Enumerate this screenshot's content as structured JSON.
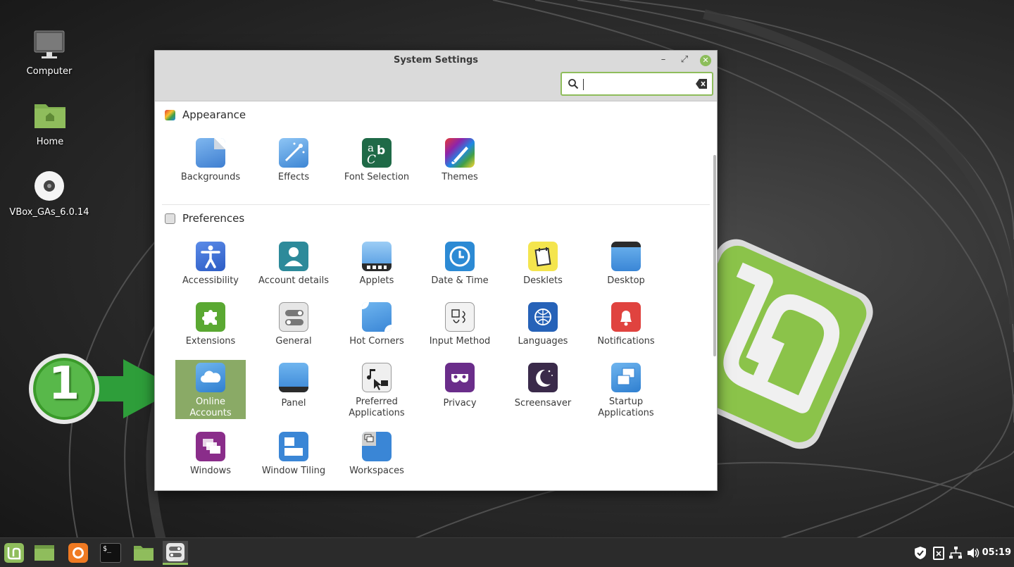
{
  "desktop": {
    "icons": [
      {
        "label": "Computer"
      },
      {
        "label": "Home"
      },
      {
        "label": "VBox_GAs_6.0.14"
      }
    ]
  },
  "window": {
    "title": "System Settings",
    "controls": {
      "minimize": "–",
      "maximize": "⤢",
      "close": "✕"
    },
    "search": {
      "value": "",
      "placeholder": ""
    }
  },
  "sections": [
    {
      "title": "Appearance",
      "items": [
        {
          "label": "Backgrounds",
          "icon": "backgrounds-icon"
        },
        {
          "label": "Effects",
          "icon": "effects-icon"
        },
        {
          "label": "Font Selection",
          "icon": "font-selection-icon"
        },
        {
          "label": "Themes",
          "icon": "themes-icon"
        }
      ]
    },
    {
      "title": "Preferences",
      "items": [
        {
          "label": "Accessibility",
          "icon": "accessibility-icon"
        },
        {
          "label": "Account details",
          "icon": "account-details-icon"
        },
        {
          "label": "Applets",
          "icon": "applets-icon"
        },
        {
          "label": "Date & Time",
          "icon": "date-time-icon"
        },
        {
          "label": "Desklets",
          "icon": "desklets-icon"
        },
        {
          "label": "Desktop",
          "icon": "desktop-icon"
        },
        {
          "label": "Extensions",
          "icon": "extensions-icon"
        },
        {
          "label": "General",
          "icon": "general-icon"
        },
        {
          "label": "Hot Corners",
          "icon": "hot-corners-icon"
        },
        {
          "label": "Input Method",
          "icon": "input-method-icon"
        },
        {
          "label": "Languages",
          "icon": "languages-icon"
        },
        {
          "label": "Notifications",
          "icon": "notifications-icon"
        },
        {
          "label": "Online Accounts",
          "line1": "Online",
          "line2": "Accounts",
          "icon": "online-accounts-icon",
          "selected": true
        },
        {
          "label": "Panel",
          "icon": "panel-icon"
        },
        {
          "label": "Preferred Applications",
          "line1": "Preferred",
          "line2": "Applications",
          "icon": "preferred-applications-icon"
        },
        {
          "label": "Privacy",
          "icon": "privacy-icon"
        },
        {
          "label": "Screensaver",
          "icon": "screensaver-icon"
        },
        {
          "label": "Startup Applications",
          "line1": "Startup",
          "line2": "Applications",
          "icon": "startup-applications-icon"
        },
        {
          "label": "Windows",
          "icon": "windows-icon"
        },
        {
          "label": "Window Tiling",
          "icon": "window-tiling-icon"
        },
        {
          "label": "Workspaces",
          "icon": "workspaces-icon"
        }
      ]
    }
  ],
  "annotation": {
    "step": "1"
  },
  "taskbar": {
    "launchers": [
      "mint-menu-icon",
      "show-desktop-icon",
      "firefox-icon",
      "terminal-icon",
      "files-icon",
      "system-settings-icon"
    ],
    "terminal_text": "$_",
    "tray": [
      "update-shield-icon",
      "clipboard-icon",
      "network-icon",
      "volume-icon"
    ],
    "clock": "05:19"
  },
  "colors": {
    "accent": "#8fbd5c",
    "selected": "#8aaa66",
    "annotation_green": "#2e9e3a"
  }
}
